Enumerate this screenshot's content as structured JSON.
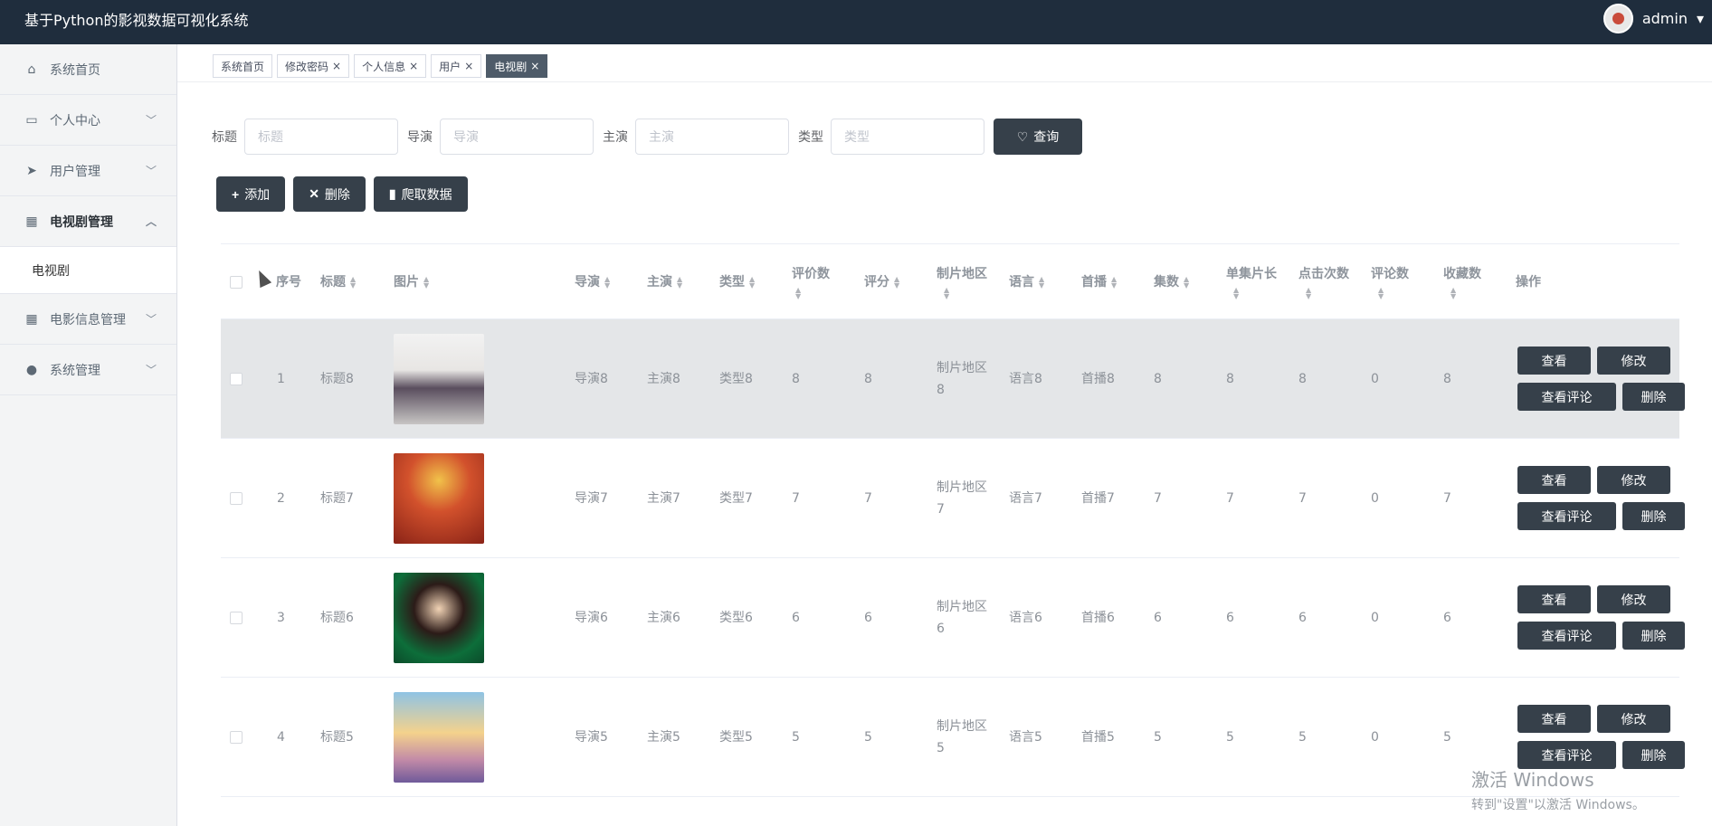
{
  "app": {
    "title": "基于Python的影视数据可视化系统",
    "username": "admin",
    "user_caret": "▾"
  },
  "sidebar": {
    "items": [
      {
        "label": "系统首页",
        "icon": "home-icon"
      },
      {
        "label": "个人中心",
        "icon": "card-icon"
      },
      {
        "label": "用户管理",
        "icon": "send-icon"
      },
      {
        "label": "电视剧管理",
        "icon": "grid-icon"
      },
      {
        "label": "电影信息管理",
        "icon": "grid-icon"
      },
      {
        "label": "系统管理",
        "icon": "user-icon"
      }
    ],
    "sub_item": "电视剧"
  },
  "tabs": [
    {
      "label": "系统首页"
    },
    {
      "label": "修改密码",
      "close": "×"
    },
    {
      "label": "个人信息",
      "close": "×"
    },
    {
      "label": "用户",
      "close": "×"
    },
    {
      "label": "电视剧",
      "close": "×"
    }
  ],
  "search": {
    "title_label": "标题",
    "title_placeholder": "标题",
    "director_label": "导演",
    "director_placeholder": "导演",
    "actor_label": "主演",
    "actor_placeholder": "主演",
    "type_label": "类型",
    "type_placeholder": "类型",
    "query_button": "查询"
  },
  "actions": {
    "add": "添加",
    "delete": "删除",
    "crawl": "爬取数据"
  },
  "table": {
    "headers": {
      "index": "序号",
      "title": "标题",
      "image": "图片",
      "director": "导演",
      "actor": "主演",
      "type": "类型",
      "review_count": "评价数",
      "score": "评分",
      "region": "制片地区",
      "language": "语言",
      "premiere": "首播",
      "episodes": "集数",
      "episode_length": "单集片长",
      "clicks": "点击次数",
      "comments": "评论数",
      "favorites": "收藏数",
      "ops": "操作"
    },
    "rows": [
      {
        "index": "1",
        "title": "标题8",
        "director": "导演8",
        "actor": "主演8",
        "type": "类型8",
        "review_count": "8",
        "score": "8",
        "region_a": "制片地区",
        "region_b": "8",
        "language": "语言8",
        "premiere": "首播8",
        "episodes": "8",
        "episode_length": "8",
        "clicks": "8",
        "comments": "0",
        "favorites": "8"
      },
      {
        "index": "2",
        "title": "标题7",
        "director": "导演7",
        "actor": "主演7",
        "type": "类型7",
        "review_count": "7",
        "score": "7",
        "region_a": "制片地区",
        "region_b": "7",
        "language": "语言7",
        "premiere": "首播7",
        "episodes": "7",
        "episode_length": "7",
        "clicks": "7",
        "comments": "0",
        "favorites": "7"
      },
      {
        "index": "3",
        "title": "标题6",
        "director": "导演6",
        "actor": "主演6",
        "type": "类型6",
        "review_count": "6",
        "score": "6",
        "region_a": "制片地区",
        "region_b": "6",
        "language": "语言6",
        "premiere": "首播6",
        "episodes": "6",
        "episode_length": "6",
        "clicks": "6",
        "comments": "0",
        "favorites": "6"
      },
      {
        "index": "4",
        "title": "标题5",
        "director": "导演5",
        "actor": "主演5",
        "type": "类型5",
        "review_count": "5",
        "score": "5",
        "region_a": "制片地区",
        "region_b": "5",
        "language": "语言5",
        "premiere": "首播5",
        "episodes": "5",
        "episode_length": "5",
        "clicks": "5",
        "comments": "0",
        "favorites": "5"
      }
    ],
    "row_ops": {
      "view": "查看",
      "edit": "修改",
      "view_comments": "查看评论",
      "delete": "删除"
    }
  },
  "watermark": {
    "line1": "激活 Windows",
    "line2": "转到\"设置\"以激活 Windows。"
  }
}
